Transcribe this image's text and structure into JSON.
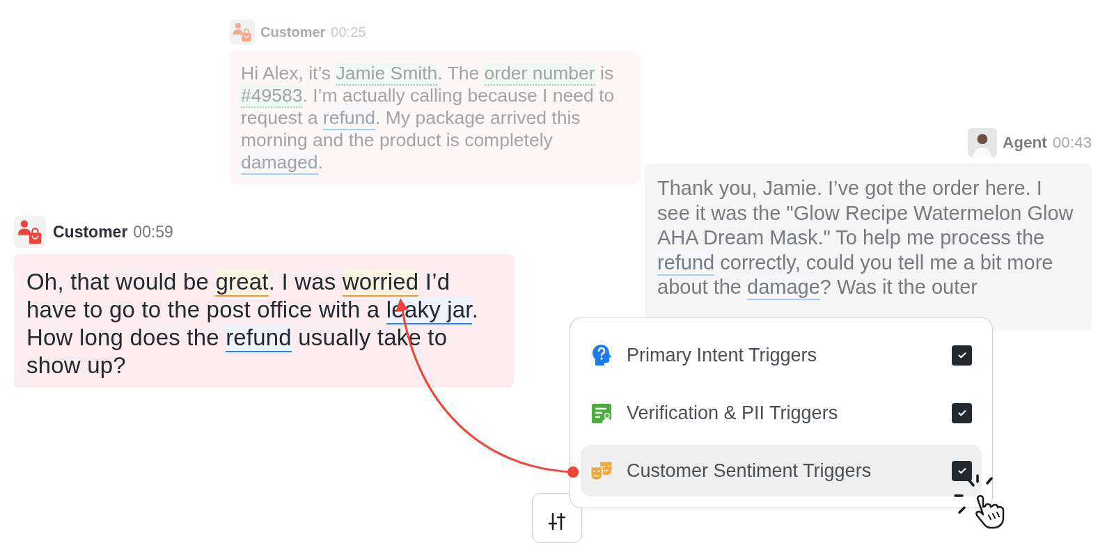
{
  "messages": [
    {
      "speaker": "Customer",
      "kind": "customer",
      "time": "00:25",
      "dimmed": true,
      "segments": [
        {
          "text": "Hi Alex, it’s ",
          "kind": "plain"
        },
        {
          "text": "Jamie Smith",
          "kind": "pii"
        },
        {
          "text": ". The ",
          "kind": "plain"
        },
        {
          "text": "order number",
          "kind": "pii"
        },
        {
          "text": " is ",
          "kind": "plain"
        },
        {
          "text": "#49583",
          "kind": "pii"
        },
        {
          "text": ". I’m actually calling because I need to request a ",
          "kind": "plain"
        },
        {
          "text": "refund",
          "kind": "intent"
        },
        {
          "text": ". My package arrived this morning and the product is completely ",
          "kind": "plain"
        },
        {
          "text": "damaged",
          "kind": "intent"
        },
        {
          "text": ".",
          "kind": "plain"
        }
      ]
    },
    {
      "speaker": "Agent",
      "kind": "agent",
      "time": "00:43",
      "dimmed": true,
      "segments": [
        {
          "text": "Thank you, Jamie. I’ve got the order here. I see it was the \"Glow Recipe Watermelon Glow AHA Dream Mask.\" To help me process the ",
          "kind": "plain"
        },
        {
          "text": "refund",
          "kind": "intent"
        },
        {
          "text": " correctly, could you tell me a bit more about the ",
          "kind": "plain"
        },
        {
          "text": "damage",
          "kind": "intent"
        },
        {
          "text": "? Was it the outer",
          "kind": "plain"
        }
      ]
    },
    {
      "speaker": "Customer",
      "kind": "customer",
      "time": "00:59",
      "dimmed": false,
      "segments": [
        {
          "text": "Oh, that would be ",
          "kind": "plain"
        },
        {
          "text": "great",
          "kind": "sentiment"
        },
        {
          "text": ". I was ",
          "kind": "plain"
        },
        {
          "text": "worried",
          "kind": "sentiment"
        },
        {
          "text": " I’d have to go to the post office with a ",
          "kind": "plain"
        },
        {
          "text": "leaky jar",
          "kind": "intent"
        },
        {
          "text": ". How long does the ",
          "kind": "plain"
        },
        {
          "text": "refund",
          "kind": "intent"
        },
        {
          "text": " usually take to show up?",
          "kind": "plain"
        }
      ]
    }
  ],
  "trigger_menu": {
    "items": [
      {
        "label": "Primary Intent Triggers",
        "kind": "intent",
        "checked": true,
        "selected": false
      },
      {
        "label": "Verification & PII Triggers",
        "kind": "pii",
        "checked": true,
        "selected": false
      },
      {
        "label": "Customer Sentiment Triggers",
        "kind": "sentiment",
        "checked": true,
        "selected": true
      }
    ]
  }
}
